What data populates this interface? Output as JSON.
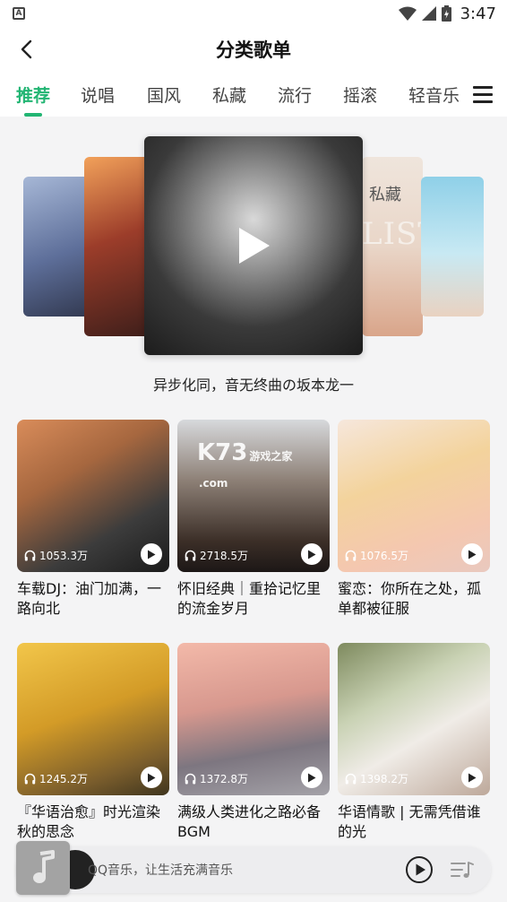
{
  "status_bar": {
    "time": "3:47"
  },
  "header": {
    "title": "分类歌单"
  },
  "tabs": [
    {
      "label": "推荐",
      "active": true
    },
    {
      "label": "说唱"
    },
    {
      "label": "国风"
    },
    {
      "label": "私藏"
    },
    {
      "label": "流行"
    },
    {
      "label": "摇滚"
    },
    {
      "label": "轻音乐"
    }
  ],
  "banner": {
    "caption": "异步化同，音无终曲の坂本龙一",
    "side_cover_text_1": "私藏",
    "side_cover_text_2": "LIST"
  },
  "watermark": {
    "main": "K73",
    "sub": "游戏之家",
    "domain": ".com"
  },
  "playlists": [
    {
      "plays": "1053.3万",
      "title": "车载DJ：油门加满，一路向北"
    },
    {
      "plays": "2718.5万",
      "title": "怀旧经典｜重拾记忆里的流金岁月"
    },
    {
      "plays": "1076.5万",
      "title": "蜜恋：你所在之处，孤单都被征服"
    },
    {
      "plays": "1245.2万",
      "title": "『华语治愈』时光渲染秋的思念"
    },
    {
      "plays": "1372.8万",
      "title": "满级人类进化之路必备BGM"
    },
    {
      "plays": "1398.2万",
      "title": "华语情歌 | 无需凭借谁的光"
    }
  ],
  "mini_player": {
    "text": "QQ音乐，让生活充满音乐"
  },
  "colors": {
    "accent": "#22b573",
    "background": "#f4f4f5"
  },
  "icons": [
    "back-arrow-icon",
    "menu-icon",
    "play-icon",
    "headphone-icon",
    "music-note-icon",
    "playlist-icon",
    "wifi-icon",
    "signal-icon",
    "battery-icon"
  ]
}
